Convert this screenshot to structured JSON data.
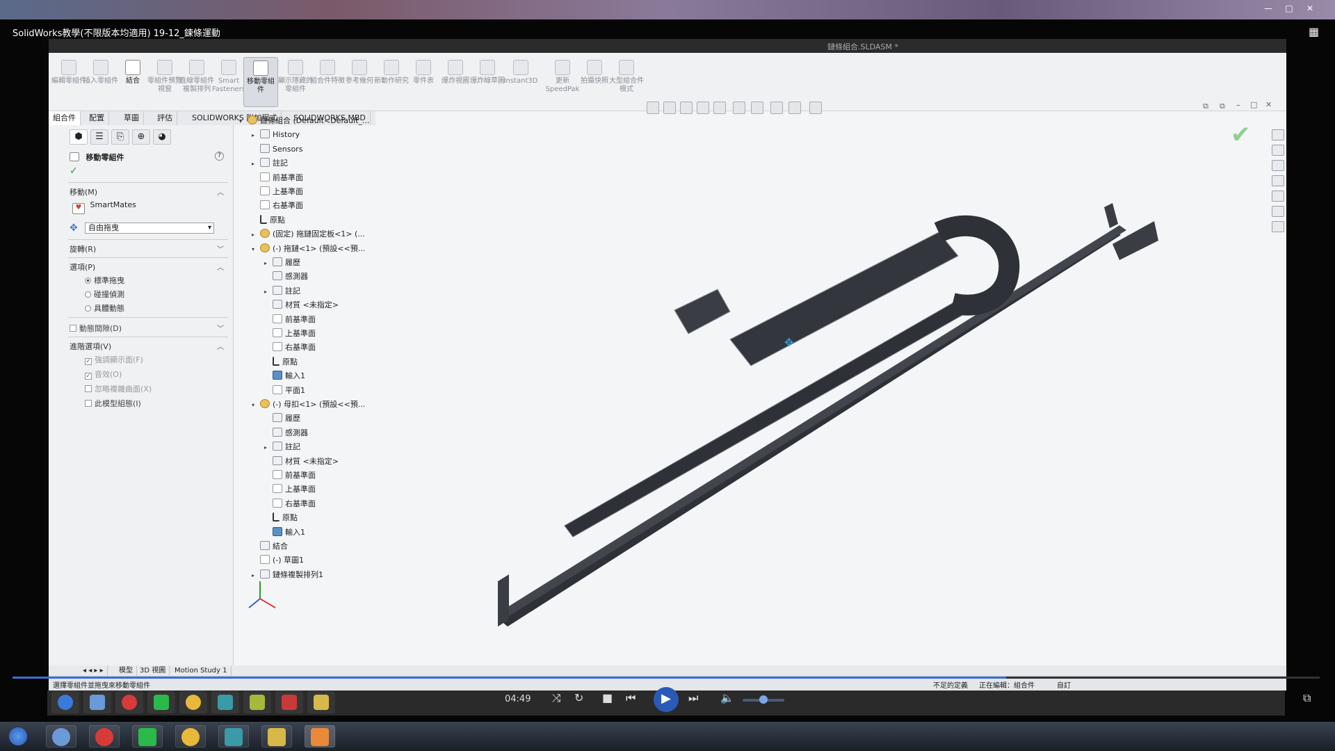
{
  "player": {
    "window_title": "SolidWorks教學(不限版本均適用) 19-12_鍊條運動",
    "time": "04:49",
    "progress": 0.76,
    "volume": 0.5
  },
  "sw": {
    "titlebar_text": "鏈條組合.SLDASM *",
    "ribbon": [
      {
        "label": "編輯零組件",
        "state": "dim"
      },
      {
        "label": "插入零組件",
        "state": "dim"
      },
      {
        "label": "結合",
        "state": "active"
      },
      {
        "label": "零組件預覽視窗",
        "state": "dim"
      },
      {
        "label": "直線零組件複製排列",
        "state": "dim"
      },
      {
        "label": "Smart Fasteners",
        "state": "dim"
      },
      {
        "label": "移動零組件",
        "state": "selected"
      },
      {
        "label": "顯示隱藏的零組件",
        "state": "dim"
      },
      {
        "label": "組合件特徵",
        "state": "dim"
      },
      {
        "label": "參考幾何",
        "state": "dim"
      },
      {
        "label": "新動作研究",
        "state": "dim"
      },
      {
        "label": "零件表",
        "state": "dim"
      },
      {
        "label": "爆炸視圖",
        "state": "dim"
      },
      {
        "label": "爆炸線草圖",
        "state": "dim"
      },
      {
        "label": "Instant3D",
        "state": "dim"
      },
      {
        "label": "更新 SpeedPak",
        "state": "dim"
      },
      {
        "label": "拍攝快照",
        "state": "dim"
      },
      {
        "label": "大型組合件模式",
        "state": "dim"
      }
    ],
    "tabs": [
      "組合件",
      "配置",
      "草圖",
      "評估",
      "SOLIDWORKS 附加程式",
      "SOLIDWORKS MBD"
    ],
    "active_tab": "組合件",
    "panel": {
      "title": "移動零組件",
      "help": "?",
      "move_header": "移動(M)",
      "smartmates": "SmartMates",
      "move_option": "自由拖曳",
      "rotate_header": "旋轉(R)",
      "options_header": "選項(P)",
      "radio": [
        "標準拖曳",
        "碰撞偵測",
        "具體動態"
      ],
      "dynamic_clearance": "動態間隙(D)",
      "advanced_header": "進階選項(V)",
      "advanced": [
        {
          "label": "強調顯示面(F)",
          "checked": true
        },
        {
          "label": "音效(O)",
          "checked": true
        },
        {
          "label": "忽略複雜曲面(X)",
          "checked": false
        },
        {
          "label": "此模型組態(I)",
          "checked": false
        }
      ]
    },
    "tree": [
      {
        "label": "鏈條組合 (Default<Default_...",
        "indent": 0,
        "exp": "▾",
        "icon": "comp"
      },
      {
        "label": "History",
        "indent": 1,
        "exp": "▸",
        "icon": "folder"
      },
      {
        "label": "Sensors",
        "indent": 1,
        "exp": "",
        "icon": "folder"
      },
      {
        "label": "註記",
        "indent": 1,
        "exp": "▸",
        "icon": "folder"
      },
      {
        "label": "前基準面",
        "indent": 1,
        "exp": "",
        "icon": "plane"
      },
      {
        "label": "上基準面",
        "indent": 1,
        "exp": "",
        "icon": "plane"
      },
      {
        "label": "右基準面",
        "indent": 1,
        "exp": "",
        "icon": "plane"
      },
      {
        "label": "原點",
        "indent": 1,
        "exp": "",
        "icon": "origin"
      },
      {
        "label": "(固定) 拖鏈固定板<1> (...",
        "indent": 1,
        "exp": "▸",
        "icon": "comp"
      },
      {
        "label": "(-) 拖鏈<1> (預設<<預...",
        "indent": 1,
        "exp": "▾",
        "icon": "comp"
      },
      {
        "label": "履歷",
        "indent": 2,
        "exp": "▸",
        "icon": "folder"
      },
      {
        "label": "感測器",
        "indent": 2,
        "exp": "",
        "icon": "folder"
      },
      {
        "label": "註記",
        "indent": 2,
        "exp": "▸",
        "icon": "folder"
      },
      {
        "label": "材質 <未指定>",
        "indent": 2,
        "exp": "",
        "icon": "folder"
      },
      {
        "label": "前基準面",
        "indent": 2,
        "exp": "",
        "icon": "plane"
      },
      {
        "label": "上基準面",
        "indent": 2,
        "exp": "",
        "icon": "plane"
      },
      {
        "label": "右基準面",
        "indent": 2,
        "exp": "",
        "icon": "plane"
      },
      {
        "label": "原點",
        "indent": 2,
        "exp": "",
        "icon": "origin"
      },
      {
        "label": "輸入1",
        "indent": 2,
        "exp": "",
        "icon": "blue"
      },
      {
        "label": "平面1",
        "indent": 2,
        "exp": "",
        "icon": "plane"
      },
      {
        "label": "(-) 母扣<1> (預設<<預...",
        "indent": 1,
        "exp": "▾",
        "icon": "comp"
      },
      {
        "label": "履歷",
        "indent": 2,
        "exp": "",
        "icon": "folder"
      },
      {
        "label": "感測器",
        "indent": 2,
        "exp": "",
        "icon": "folder"
      },
      {
        "label": "註記",
        "indent": 2,
        "exp": "▸",
        "icon": "folder"
      },
      {
        "label": "材質 <未指定>",
        "indent": 2,
        "exp": "",
        "icon": "folder"
      },
      {
        "label": "前基準面",
        "indent": 2,
        "exp": "",
        "icon": "plane"
      },
      {
        "label": "上基準面",
        "indent": 2,
        "exp": "",
        "icon": "plane"
      },
      {
        "label": "右基準面",
        "indent": 2,
        "exp": "",
        "icon": "plane"
      },
      {
        "label": "原點",
        "indent": 2,
        "exp": "",
        "icon": "origin"
      },
      {
        "label": "輸入1",
        "indent": 2,
        "exp": "",
        "icon": "blue"
      },
      {
        "label": "結合",
        "indent": 1,
        "exp": "",
        "icon": "folder"
      },
      {
        "label": "(-) 草圖1",
        "indent": 1,
        "exp": "",
        "icon": "plane"
      },
      {
        "label": "鏈條複製排列1",
        "indent": 1,
        "exp": "▸",
        "icon": "folder"
      }
    ],
    "bottom_tabs": [
      "模型",
      "3D 視圖",
      "Motion Study 1"
    ],
    "status_left": "選擇零組件並拖曳來移動零組件",
    "status_right": [
      "不足的定義",
      "正在編輯：組合件",
      "自訂"
    ]
  },
  "colors": {
    "accent": "#3a6fd8",
    "check": "#2e9a2e"
  }
}
